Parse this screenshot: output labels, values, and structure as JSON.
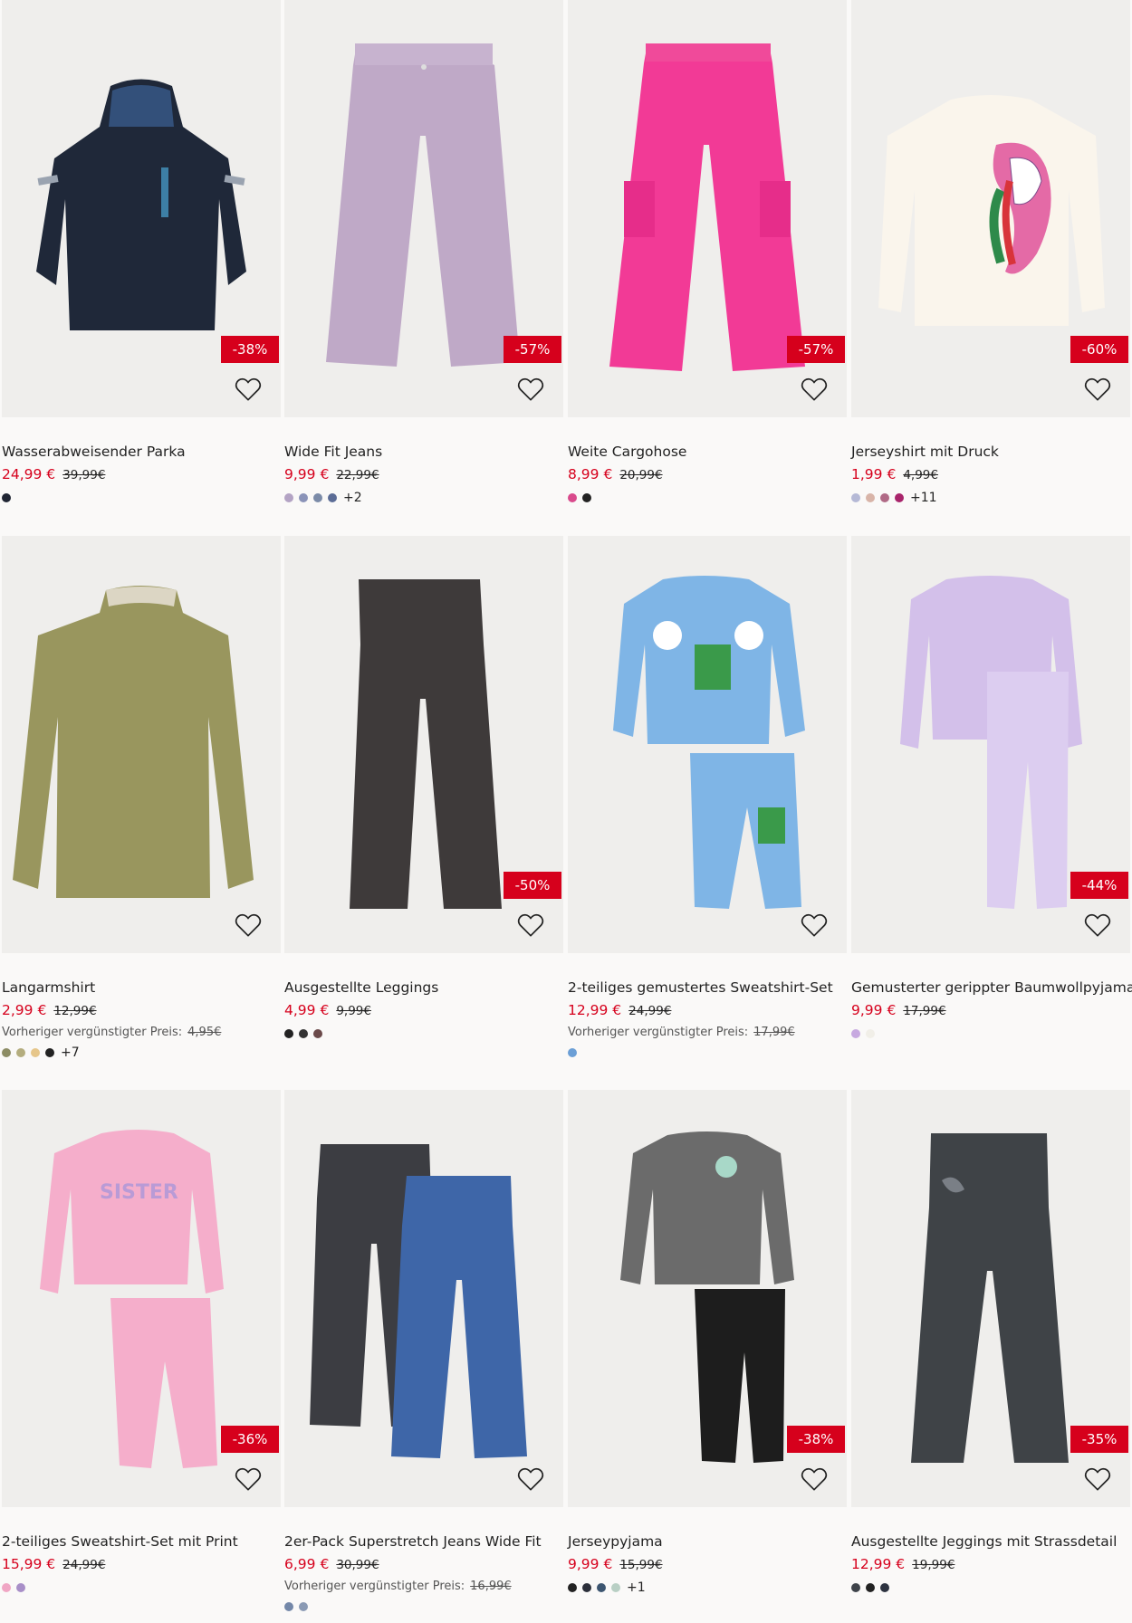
{
  "products": [
    {
      "title": "Wasserabweisender Parka",
      "price": "24,99 €",
      "old_price": "39,99€",
      "badge": "-38%",
      "prev_label": "",
      "prev_price": "",
      "colors": [
        "#1f2533"
      ],
      "more": ""
    },
    {
      "title": "Wide Fit Jeans",
      "price": "9,99 €",
      "old_price": "22,99€",
      "badge": "-57%",
      "prev_label": "",
      "prev_price": "",
      "colors": [
        "#b3a3c4",
        "#8a93b8",
        "#7b8ba8",
        "#5b6c96"
      ],
      "more": "+2"
    },
    {
      "title": "Weite Cargohose",
      "price": "8,99 €",
      "old_price": "20,99€",
      "badge": "-57%",
      "prev_label": "",
      "prev_price": "",
      "colors": [
        "#d94a8c",
        "#222222"
      ],
      "more": ""
    },
    {
      "title": "Jerseyshirt mit Druck",
      "price": "1,99 €",
      "old_price": "4,99€",
      "badge": "-60%",
      "prev_label": "",
      "prev_price": "",
      "colors": [
        "#b5b9d6",
        "#d8b4a8",
        "#b06a86",
        "#a8246b"
      ],
      "more": "+11"
    },
    {
      "title": "Langarmshirt",
      "price": "2,99 €",
      "old_price": "12,99€",
      "badge": "",
      "prev_label": "Vorheriger vergünstigter Preis:",
      "prev_price": "4,95€",
      "colors": [
        "#8c8c64",
        "#b4ad7e",
        "#e6c68a",
        "#222222"
      ],
      "more": "+7"
    },
    {
      "title": "Ausgestellte Leggings",
      "price": "4,99 €",
      "old_price": "9,99€",
      "badge": "-50%",
      "prev_label": "",
      "prev_price": "",
      "colors": [
        "#222222",
        "#333333",
        "#6b4a4a"
      ],
      "more": ""
    },
    {
      "title": "2-teiliges gemustertes Sweatshirt-Set",
      "price": "12,99 €",
      "old_price": "24,99€",
      "badge": "",
      "prev_label": "Vorheriger vergünstigter Preis:",
      "prev_price": "17,99€",
      "colors": [
        "#6b9fd6"
      ],
      "more": ""
    },
    {
      "title": "Gemusterter gerippter Baumwollpyjama",
      "price": "9,99 €",
      "old_price": "17,99€",
      "badge": "-44%",
      "prev_label": "",
      "prev_price": "",
      "colors": [
        "#c7a9e0",
        "#f1efe8"
      ],
      "more": ""
    },
    {
      "title": "2-teiliges Sweatshirt-Set mit Print",
      "price": "15,99 €",
      "old_price": "24,99€",
      "badge": "-36%",
      "prev_label": "",
      "prev_price": "",
      "colors": [
        "#f0a6c4",
        "#a88fc8"
      ],
      "more": ""
    },
    {
      "title": "2er-Pack Superstretch Jeans Wide Fit",
      "price": "6,99 €",
      "old_price": "30,99€",
      "badge": "",
      "prev_label": "Vorheriger vergünstigter Preis:",
      "prev_price": "16,99€",
      "colors": [
        "#7387a8",
        "#8a9ab4"
      ],
      "more": ""
    },
    {
      "title": "Jerseypyjama",
      "price": "9,99 €",
      "old_price": "15,99€",
      "badge": "-38%",
      "prev_label": "",
      "prev_price": "",
      "colors": [
        "#222222",
        "#2b2f3a",
        "#3c5570",
        "#b8cfc4"
      ],
      "more": "+1"
    },
    {
      "title": "Ausgestellte Jeggings mit Strassdetail",
      "price": "12,99 €",
      "old_price": "19,99€",
      "badge": "-35%",
      "prev_label": "",
      "prev_price": "",
      "colors": [
        "#3e434a",
        "#222222",
        "#2d3340"
      ],
      "more": ""
    }
  ],
  "icons": {
    "wishlist": "heart-outline-icon"
  }
}
